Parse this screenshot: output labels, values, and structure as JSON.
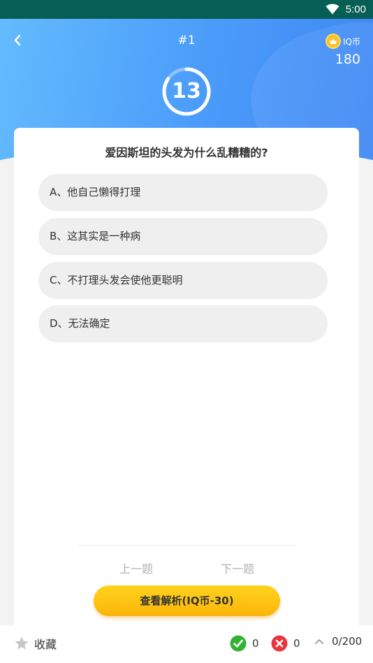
{
  "status_bar": {
    "time": "5:00",
    "icon": "wifi-icon"
  },
  "header": {
    "question_number": "#1",
    "iq_label": "IQ币",
    "iq_value": "180",
    "timer_value": "13",
    "back_icon": "chevron-left-icon",
    "coin_icon": "coin-icon"
  },
  "quiz": {
    "question": "爱因斯坦的头发为什么乱糟糟的?",
    "options": [
      {
        "label": "A、他自己懒得打理"
      },
      {
        "label": "B、这其实是一种病"
      },
      {
        "label": "C、不打理头发会使他更聪明"
      },
      {
        "label": "D、无法确定"
      }
    ],
    "prev_label": "上一题",
    "next_label": "下一题",
    "analysis_label": "查看解析(IQ币-30)"
  },
  "bottom_bar": {
    "favorite_label": "收藏",
    "correct_count": "0",
    "wrong_count": "0",
    "progress": "0/200"
  },
  "colors": {
    "status_bar": "#075e54",
    "header_gradient_start": "#64bbfd",
    "header_gradient_end": "#3d86f4",
    "accent_button": "#fcb40a",
    "correct": "#34b233",
    "wrong": "#e8363f"
  }
}
